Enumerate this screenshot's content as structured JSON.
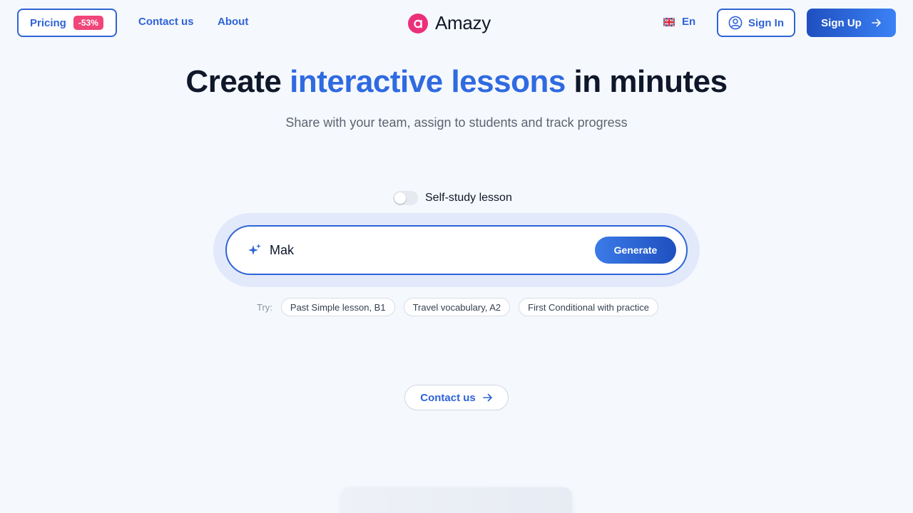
{
  "header": {
    "pricing_label": "Pricing",
    "discount_badge": "-53%",
    "nav_contact": "Contact us",
    "nav_about": "About",
    "brand_name": "Amazy",
    "language": "En",
    "signin_label": "Sign In",
    "signup_label": "Sign Up"
  },
  "hero": {
    "title_pre": "Create ",
    "title_accent": "interactive lessons",
    "title_post": " in minutes",
    "subtitle": "Share with your team, assign to students and track progress"
  },
  "lesson_form": {
    "toggle_label": "Self-study lesson",
    "toggle_on": false,
    "prompt_value": "Mak",
    "generate_label": "Generate",
    "try_label": "Try:",
    "suggestions": [
      "Past Simple lesson, B1",
      "Travel vocabulary, A2",
      "First Conditional with practice"
    ]
  },
  "footer_cta": {
    "contact_label": "Contact us"
  },
  "colors": {
    "primary": "#2f64d6",
    "accent_pink": "#ec2f7a",
    "badge": "#f0467a",
    "background": "#f5f8fd"
  },
  "icons": {
    "logo": "amazy-logo-icon",
    "flag": "uk-flag-icon",
    "user": "user-circle-icon",
    "arrow": "arrow-right-icon",
    "sparkle": "sparkle-icon"
  }
}
